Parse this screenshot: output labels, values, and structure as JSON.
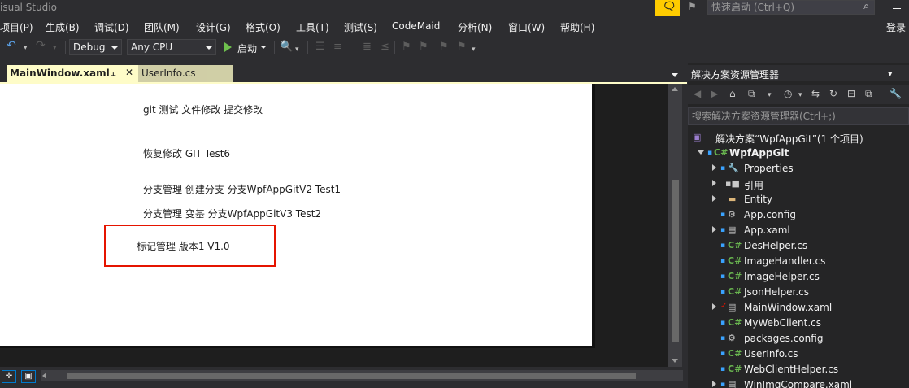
{
  "window": {
    "title": "isual Studio"
  },
  "quick_launch": {
    "placeholder": "快速启动 (Ctrl+Q)"
  },
  "menu": {
    "items": [
      "项目(P)",
      "生成(B)",
      "调试(D)",
      "团队(M)",
      "设计(G)",
      "格式(O)",
      "工具(T)",
      "测试(S)",
      "CodeMaid",
      "分析(N)",
      "窗口(W)",
      "帮助(H)"
    ],
    "login": "登录"
  },
  "toolbar": {
    "config": "Debug",
    "platform": "Any CPU",
    "start_label": "启动"
  },
  "tabs": [
    {
      "label": "MainWindow.xaml",
      "active": true
    },
    {
      "label": "UserInfo.cs",
      "active": false
    }
  ],
  "canvas": {
    "lines": [
      "git 测试 文件修改 提交修改",
      "恢复修改 GIT Test6",
      "分支管理 创建分支 分支WpfAppGitV2 Test1",
      "分支管理   变基   分支WpfAppGitV3 Test2",
      "标记管理   版本1   V1.0"
    ],
    "highlight_color": "#e51400"
  },
  "solution_explorer": {
    "title": "解决方案资源管理器",
    "search_placeholder": "搜索解决方案资源管理器(Ctrl+;)",
    "solution": "解决方案“WpfAppGit”(1 个项目)",
    "project": "WpfAppGit",
    "items": [
      "Properties",
      "引用",
      "Entity",
      "App.config",
      "App.xaml",
      "DesHelper.cs",
      "ImageHandler.cs",
      "ImageHelper.cs",
      "JsonHelper.cs",
      "MainWindow.xaml",
      "MyWebClient.cs",
      "packages.config",
      "UserInfo.cs",
      "WebClientHelper.cs",
      "WinImgCompare.xaml"
    ]
  },
  "colors": {
    "background": "#2d2d30",
    "accent": "#007acc",
    "tab": "#fefcc8",
    "feedback": "#ffcc00"
  }
}
